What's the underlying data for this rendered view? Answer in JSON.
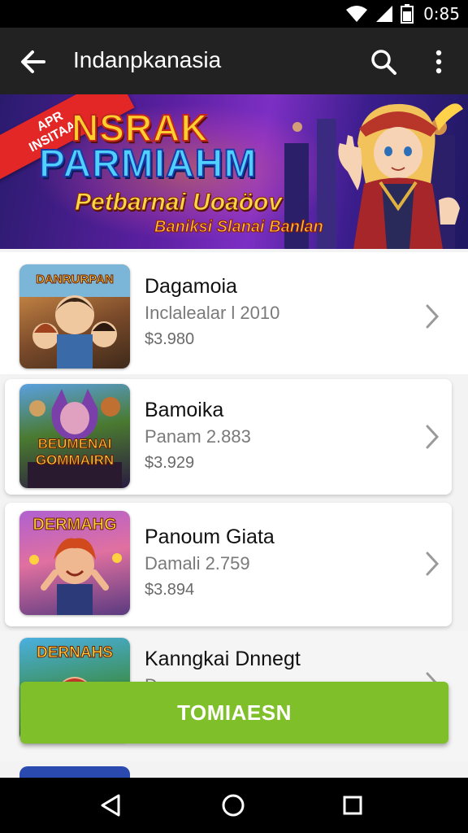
{
  "status_bar": {
    "time": "0:85",
    "icons": [
      "wifi-icon",
      "signal-icon",
      "battery-icon"
    ]
  },
  "app_bar": {
    "title": "Indanpkanasia",
    "icons": [
      "back-arrow-icon",
      "search-icon",
      "more-vert-icon"
    ]
  },
  "banner": {
    "ribbon": [
      "APR",
      "INSITAAR"
    ],
    "line1": "NSRAK",
    "line2": "PARMIAHM",
    "line3": "Petbarnai Uoaöov",
    "line4": "Baniksi Slanai Banlan"
  },
  "list": {
    "items": [
      {
        "title": "Dagamoia",
        "subtitle": "Inclalealar l 2010",
        "price": "$3.980",
        "thumb_label": "DANRURPAN"
      },
      {
        "title": "Bamoika",
        "subtitle": "Panam 2.883",
        "price": "$3.929",
        "thumb_label_1": "BEUMENAI",
        "thumb_label_2": "GOMMAIRN"
      },
      {
        "title": "Panoum Giata",
        "subtitle": "Damali 2.759",
        "price": "$3.894",
        "thumb_label": "DERMAHG"
      },
      {
        "title": "Kanngkai Dnnegt",
        "subtitle": "D",
        "thumb_label": "DERNAHS"
      }
    ]
  },
  "action_button": {
    "label": "TOMIAESN"
  },
  "colors": {
    "app_bar": "#222222",
    "action_button": "#7fbf2a",
    "banner_purple": "#5a1fa0"
  },
  "nav_bar": {
    "icons": [
      "back-triangle-icon",
      "home-circle-icon",
      "recents-square-icon"
    ]
  }
}
